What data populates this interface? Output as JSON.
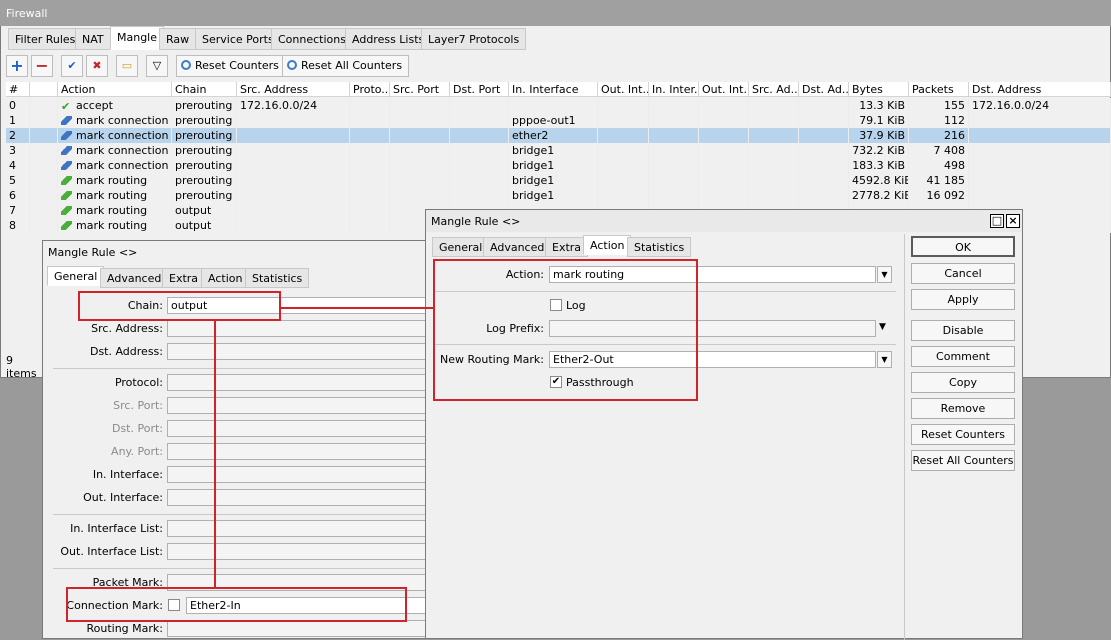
{
  "window": {
    "title": "Firewall"
  },
  "tabs": [
    "Filter Rules",
    "NAT",
    "Mangle",
    "Raw",
    "Service Ports",
    "Connections",
    "Address Lists",
    "Layer7 Protocols"
  ],
  "toolbar": {
    "reset_counters": "Reset Counters",
    "reset_all_counters": "Reset All Counters"
  },
  "table": {
    "columns": [
      "#",
      "",
      "Action",
      "Chain",
      "Src. Address",
      "Proto...",
      "Src. Port",
      "Dst. Port",
      "In. Interface",
      "Out. Int...",
      "In. Inter...",
      "Out. Int...",
      "Src. Ad...",
      "Dst. Ad...",
      "Bytes",
      "Packets",
      "Dst. Address"
    ],
    "rows": [
      {
        "num": "0",
        "action": "accept",
        "icon": "accept",
        "chain": "prerouting",
        "src": "172.16.0.0/24",
        "in_if": "",
        "bytes": "13.3 KiB",
        "packets": "155",
        "dst": "172.16.0.0/24"
      },
      {
        "num": "1",
        "action": "mark connection",
        "icon": "mc",
        "chain": "prerouting",
        "src": "",
        "in_if": "pppoe-out1",
        "bytes": "79.1 KiB",
        "packets": "112",
        "dst": ""
      },
      {
        "num": "2",
        "action": "mark connection",
        "icon": "mc",
        "chain": "prerouting",
        "src": "",
        "in_if": "ether2",
        "bytes": "37.9 KiB",
        "packets": "216",
        "dst": ""
      },
      {
        "num": "3",
        "action": "mark connection",
        "icon": "mc",
        "chain": "prerouting",
        "src": "",
        "in_if": "bridge1",
        "bytes": "732.2 KiB",
        "packets": "7 408",
        "dst": ""
      },
      {
        "num": "4",
        "action": "mark connection",
        "icon": "mc",
        "chain": "prerouting",
        "src": "",
        "in_if": "bridge1",
        "bytes": "183.3 KiB",
        "packets": "498",
        "dst": ""
      },
      {
        "num": "5",
        "action": "mark routing",
        "icon": "mr",
        "chain": "prerouting",
        "src": "",
        "in_if": "bridge1",
        "bytes": "4592.8 KiB",
        "packets": "41 185",
        "dst": ""
      },
      {
        "num": "6",
        "action": "mark routing",
        "icon": "mr",
        "chain": "prerouting",
        "src": "",
        "in_if": "bridge1",
        "bytes": "2778.2 KiB",
        "packets": "16 092",
        "dst": ""
      },
      {
        "num": "7",
        "action": "mark routing",
        "icon": "mr",
        "chain": "output",
        "src": "",
        "in_if": "",
        "bytes": "",
        "packets": "",
        "dst": ""
      },
      {
        "num": "8",
        "action": "mark routing",
        "icon": "mr",
        "chain": "output",
        "src": "",
        "in_if": "",
        "bytes": "",
        "packets": "",
        "dst": ""
      }
    ],
    "selected_row": 2
  },
  "status": {
    "items": "9 items"
  },
  "left_dialog": {
    "title": "Mangle Rule <>",
    "tabs": [
      "General",
      "Advanced",
      "Extra",
      "Action",
      "Statistics"
    ],
    "chain_label": "Chain:",
    "chain_value": "output",
    "labels": {
      "src_address": "Src. Address:",
      "dst_address": "Dst. Address:",
      "protocol": "Protocol:",
      "src_port": "Src. Port:",
      "dst_port": "Dst. Port:",
      "any_port": "Any. Port:",
      "in_interface": "In. Interface:",
      "out_interface": "Out. Interface:",
      "in_interface_list": "In. Interface List:",
      "out_interface_list": "Out. Interface List:",
      "packet_mark": "Packet Mark:",
      "connection_mark": "Connection Mark:",
      "routing_mark": "Routing Mark:"
    },
    "connection_mark_value": "Ether2-In"
  },
  "right_dialog": {
    "title": "Mangle Rule <>",
    "tabs": [
      "General",
      "Advanced",
      "Extra",
      "Action",
      "Statistics"
    ],
    "action_label": "Action:",
    "action_value": "mark routing",
    "log_label": "Log",
    "log_prefix_label": "Log Prefix:",
    "routing_mark_label": "New Routing Mark:",
    "routing_mark_value": "Ether2-Out",
    "passthrough_label": "Passthrough",
    "buttons": [
      "OK",
      "Cancel",
      "Apply",
      "Disable",
      "Comment",
      "Copy",
      "Remove",
      "Reset Counters",
      "Reset All Counters"
    ]
  },
  "colors": {
    "highlight": "#d0232a",
    "selected_row": "#b8d3ec"
  }
}
